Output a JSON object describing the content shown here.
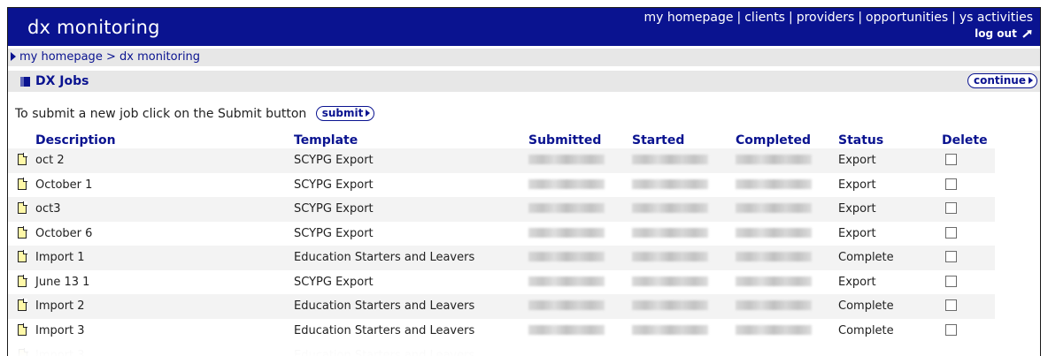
{
  "app": {
    "title": "dx monitoring"
  },
  "topnav": {
    "items": [
      "my homepage",
      "clients",
      "providers",
      "opportunities",
      "ys activities"
    ],
    "separator": "|",
    "logout_label": "log out"
  },
  "breadcrumb": {
    "home": "my homepage",
    "separator": ">",
    "current": "dx monitoring"
  },
  "section": {
    "title": "DX Jobs",
    "continue_label": "continue"
  },
  "intro": {
    "text": "To submit a new job click on the Submit button",
    "submit_label": "submit"
  },
  "table": {
    "headers": [
      "Description",
      "Template",
      "Submitted",
      "Started",
      "Completed",
      "Status",
      "Delete"
    ],
    "rows": [
      {
        "description": "oct 2",
        "template": "SCYPG Export",
        "status": "Export"
      },
      {
        "description": "October 1",
        "template": "SCYPG Export",
        "status": "Export"
      },
      {
        "description": "oct3",
        "template": "SCYPG Export",
        "status": "Export"
      },
      {
        "description": "October 6",
        "template": "SCYPG Export",
        "status": "Export"
      },
      {
        "description": "Import 1",
        "template": "Education Starters and Leavers",
        "status": "Complete"
      },
      {
        "description": "June 13 1",
        "template": "SCYPG Export",
        "status": "Export"
      },
      {
        "description": "Import 2",
        "template": "Education Starters and Leavers",
        "status": "Complete"
      },
      {
        "description": "Import 3",
        "template": "Education Starters and Leavers",
        "status": "Complete"
      }
    ]
  },
  "colors": {
    "header_blue": "#0a1390",
    "bar_gray": "#e7e7e7",
    "row_shade": "#f3f3f3",
    "doc_icon_fill": "#fff8a8"
  },
  "icons": {
    "breadcrumb": "breadcrumb-arrow-icon",
    "section": "section-block-icon",
    "logout": "logout-arrow-icon",
    "row": "document-icon",
    "button": "play-triangle-icon"
  }
}
